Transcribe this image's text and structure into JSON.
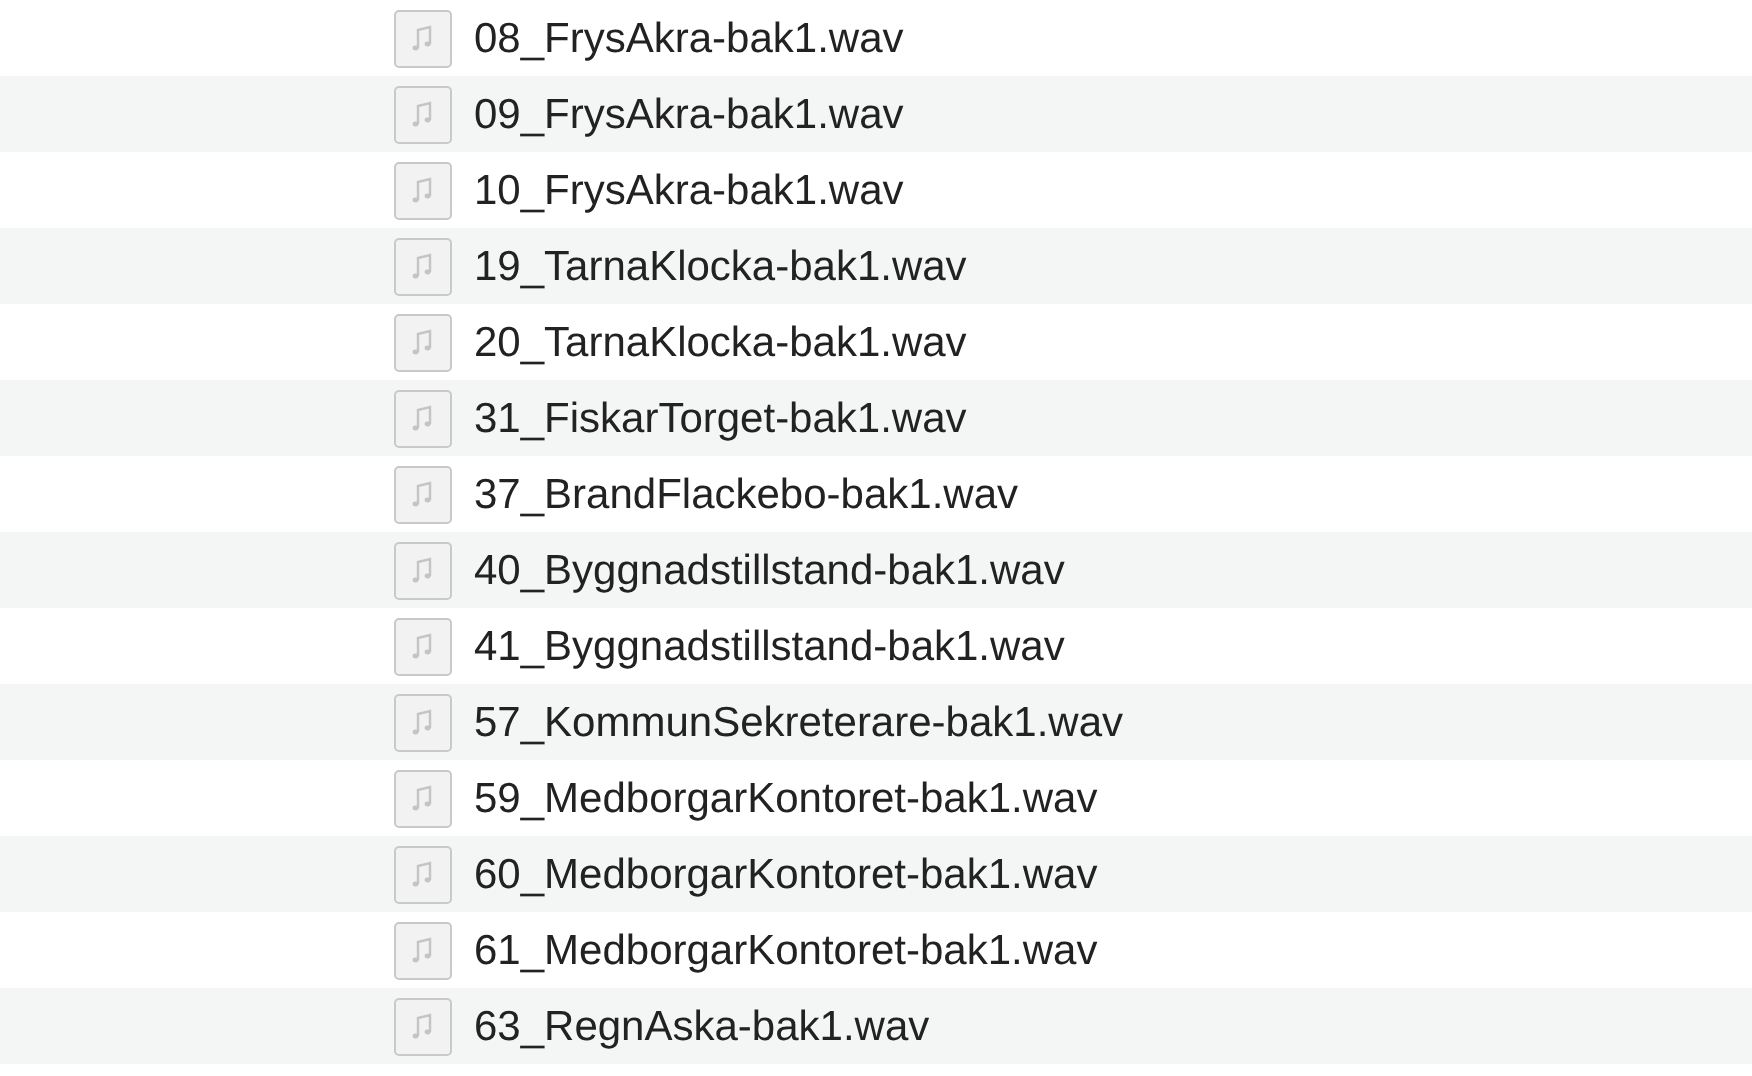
{
  "files": [
    {
      "name": "08_FrysAkra-bak1.wav"
    },
    {
      "name": "09_FrysAkra-bak1.wav"
    },
    {
      "name": "10_FrysAkra-bak1.wav"
    },
    {
      "name": "19_TarnaKlocka-bak1.wav"
    },
    {
      "name": "20_TarnaKlocka-bak1.wav"
    },
    {
      "name": "31_FiskarTorget-bak1.wav"
    },
    {
      "name": "37_BrandFlackebo-bak1.wav"
    },
    {
      "name": "40_Byggnadstillstand-bak1.wav"
    },
    {
      "name": "41_Byggnadstillstand-bak1.wav"
    },
    {
      "name": "57_KommunSekreterare-bak1.wav"
    },
    {
      "name": "59_MedborgarKontoret-bak1.wav"
    },
    {
      "name": "60_MedborgarKontoret-bak1.wav"
    },
    {
      "name": "61_MedborgarKontoret-bak1.wav"
    },
    {
      "name": "63_RegnAska-bak1.wav"
    }
  ]
}
